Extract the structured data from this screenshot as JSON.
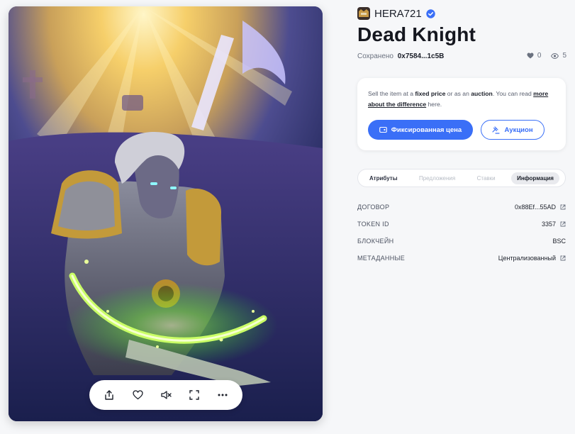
{
  "creator": {
    "name": "HERA721",
    "verified": true,
    "avatar_icon": "creator-avatar-icon"
  },
  "item": {
    "title": "Dead Knight",
    "saved_label": "Сохранено",
    "saved_address": "0x7584...1c5B",
    "likes": "0",
    "views": "5"
  },
  "media_controls": {
    "share_icon": "share-icon",
    "like_icon": "heart-icon",
    "mute_icon": "mute-icon",
    "fullscreen_icon": "fullscreen-icon",
    "more_icon": "more-icon"
  },
  "sell": {
    "text_prefix": "Sell the item at a",
    "fixed_price": "fixed price",
    "text_mid": "or as an",
    "auction": "auction",
    "text_read": ". You can read",
    "link_text": "more about the difference",
    "text_end": "here.",
    "fixed_button": "Фиксированная цена",
    "auction_button": "Аукцион"
  },
  "tabs": [
    {
      "label": "Атрибуты"
    },
    {
      "label": "Предложения"
    },
    {
      "label": "Ставки"
    },
    {
      "label": "Информация",
      "active": true
    }
  ],
  "info": [
    {
      "label": "ДОГОВОР",
      "value": "0x88Ef...55AD",
      "link": true
    },
    {
      "label": "TOKEN ID",
      "value": "3357",
      "link": true
    },
    {
      "label": "БЛОКЧЕЙН",
      "value": "BSC",
      "link": false
    },
    {
      "label": "МЕТАДАННЫЕ",
      "value": "Централизованный",
      "link": true
    }
  ],
  "colors": {
    "accent": "#3a6ff7",
    "background": "#f6f7f9",
    "glow": "#7dff3a"
  }
}
